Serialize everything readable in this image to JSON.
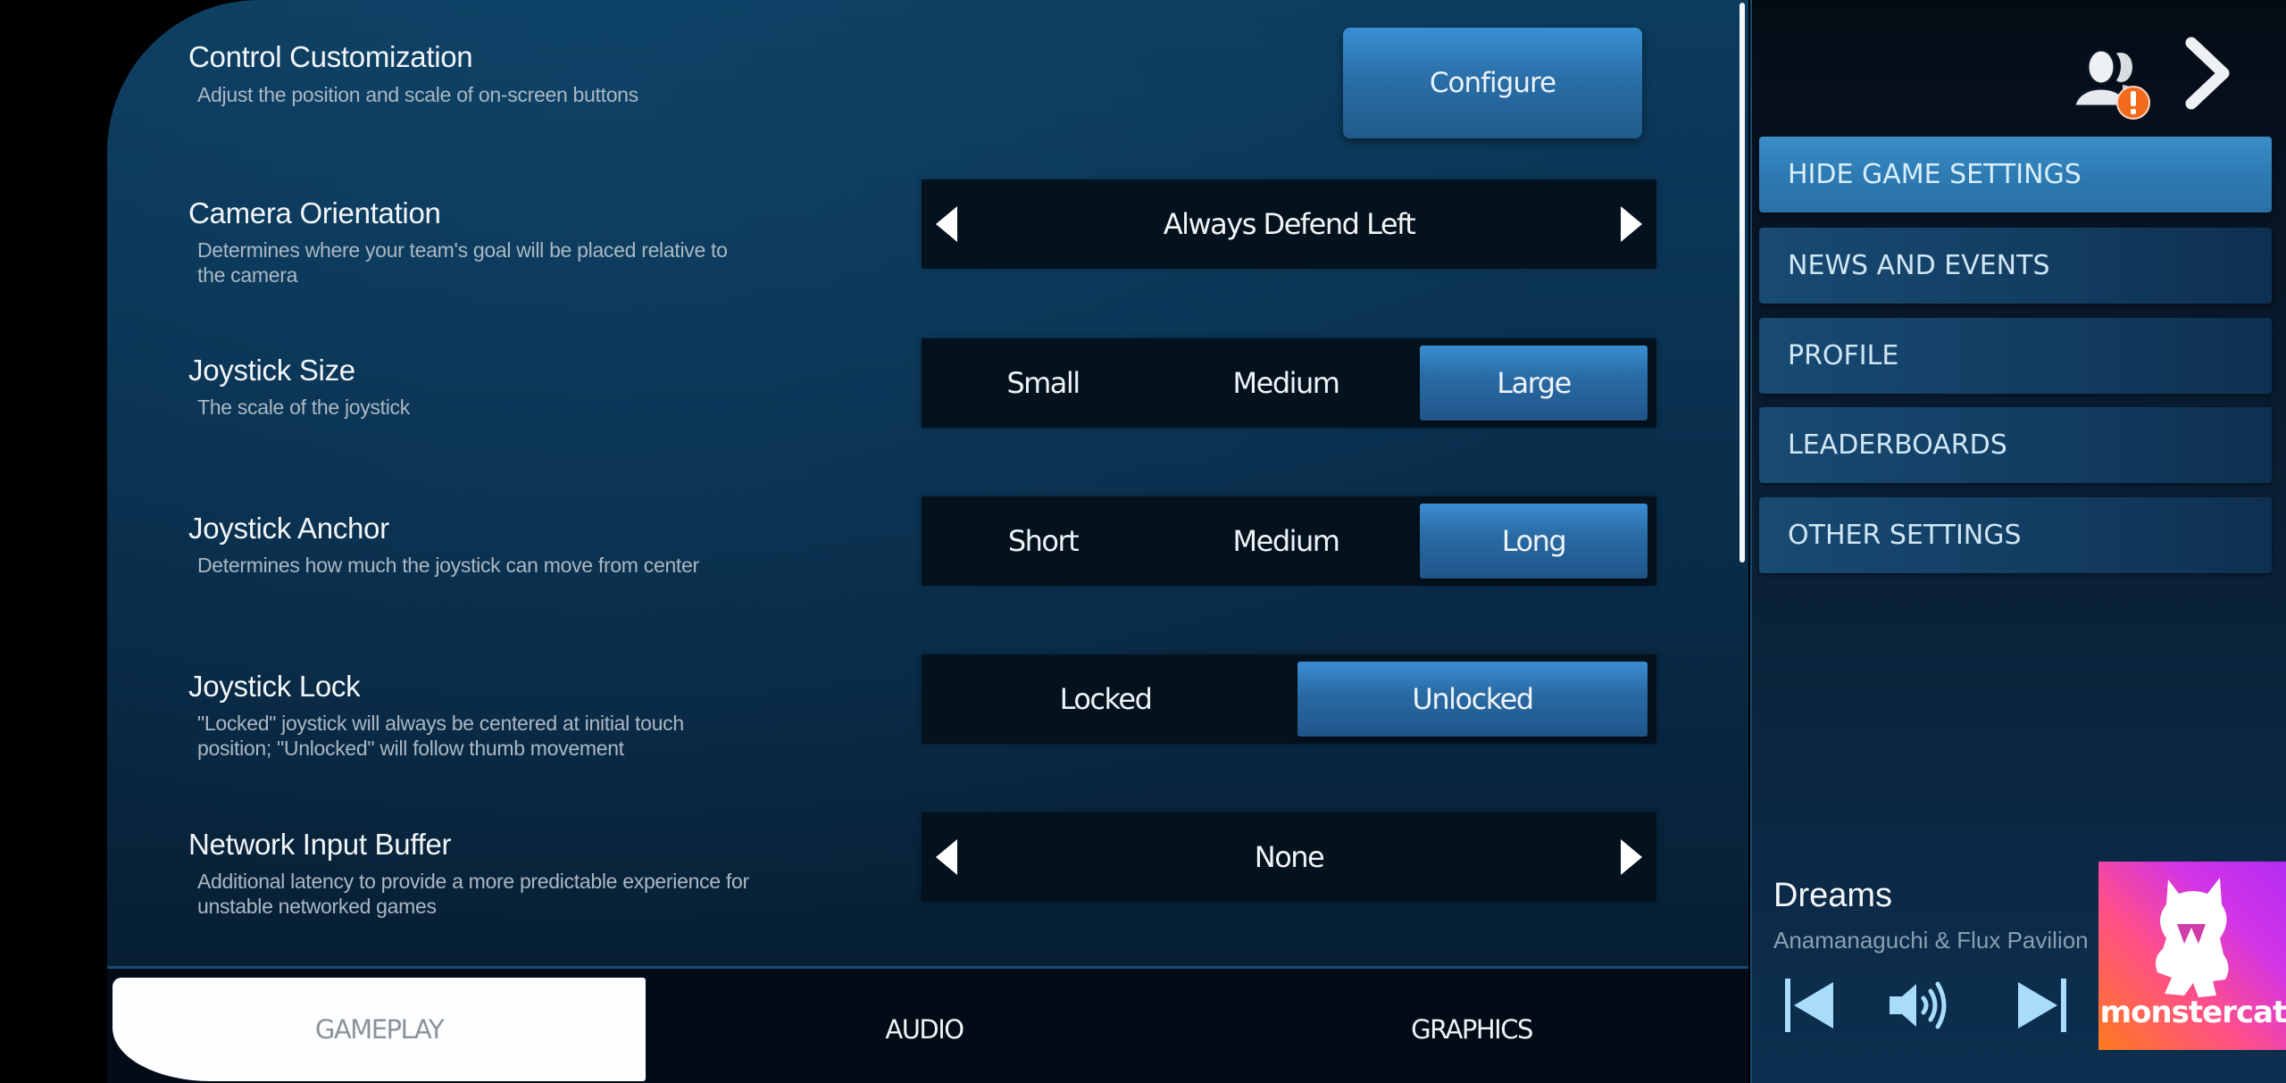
{
  "settings": {
    "control_customization": {
      "title": "Control Customization",
      "description": "Adjust the position and scale of on-screen buttons",
      "button_label": "Configure"
    },
    "camera_orientation": {
      "title": "Camera Orientation",
      "description": "Determines where your team's goal will be placed relative to the camera",
      "value": "Always Defend Left"
    },
    "joystick_size": {
      "title": "Joystick Size",
      "description": "The scale of the joystick",
      "options": [
        "Small",
        "Medium",
        "Large"
      ],
      "selected": "Large"
    },
    "joystick_anchor": {
      "title": "Joystick Anchor",
      "description": "Determines how much the joystick can move from center",
      "options": [
        "Short",
        "Medium",
        "Long"
      ],
      "selected": "Long"
    },
    "joystick_lock": {
      "title": "Joystick Lock",
      "description": "\"Locked\" joystick will always be centered at initial touch position; \"Unlocked\" will follow thumb movement",
      "options": [
        "Locked",
        "Unlocked"
      ],
      "selected": "Unlocked"
    },
    "network_input_buffer": {
      "title": "Network Input Buffer",
      "description": "Additional latency to provide a more predictable experience for unstable networked games",
      "value": "None"
    }
  },
  "tabs": [
    {
      "label": "GAMEPLAY",
      "active": true
    },
    {
      "label": "AUDIO",
      "active": false
    },
    {
      "label": "GRAPHICS",
      "active": false
    }
  ],
  "sidebar": {
    "icons": {
      "profile": "friends-alert-icon",
      "next": "chevron-right-icon"
    },
    "menu": [
      {
        "label": "HIDE GAME SETTINGS",
        "active": true
      },
      {
        "label": "NEWS AND EVENTS",
        "active": false
      },
      {
        "label": "PROFILE",
        "active": false
      },
      {
        "label": "LEADERBOARDS",
        "active": false
      },
      {
        "label": "OTHER SETTINGS",
        "active": false
      }
    ]
  },
  "now_playing": {
    "title": "Dreams",
    "artist": "Anamanaguchi & Flux Pavilion",
    "label": "monstercat",
    "controls": [
      "previous-track",
      "volume",
      "next-track"
    ]
  },
  "colors": {
    "accent_blue": "#2e7bb4",
    "alert_orange": "#f26a1b",
    "selector_bg": "#04121e"
  }
}
